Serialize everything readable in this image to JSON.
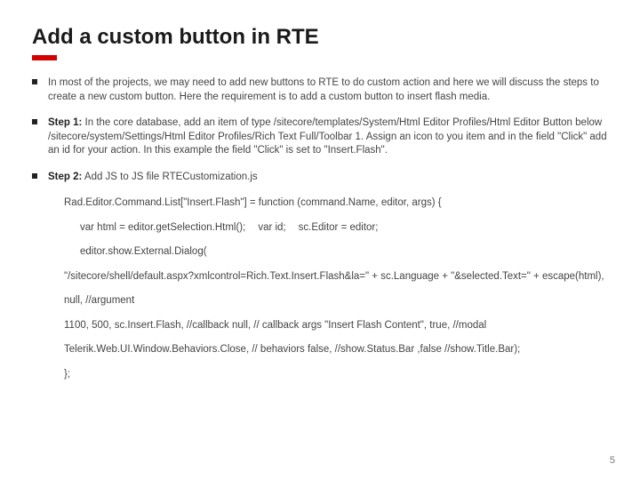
{
  "title": "Add a custom button in RTE",
  "bullets": {
    "intro": "In most of the projects, we may need to add new buttons to RTE to do custom action and here we will discuss the steps to create a new custom button. Here the requirement is to add a custom button to insert flash media.",
    "step1_label": "Step 1:",
    "step1_text": " In the core database, add an item of type /sitecore/templates/System/Html Editor Profiles/Html Editor Button below /sitecore/system/Settings/Html Editor Profiles/Rich Text Full/Toolbar 1. Assign an icon to you item and in the field \"Click\" add an id for your action. In this example the field \"Click\" is set to \"Insert.Flash\".",
    "step2_label": "Step 2:",
    "step2_text": " Add JS  to JS file RTECustomization.js"
  },
  "code": {
    "l1": "Rad.Editor.Command.List[\"Insert.Flash\"] = function (command.Name, editor, args) {",
    "l2a": "var html = editor.getSelection.Html();",
    "l2b": "var id;",
    "l2c": "sc.Editor = editor;",
    "l3": "editor.show.External.Dialog(",
    "l4": "\"/sitecore/shell/default.aspx?xmlcontrol=Rich.Text.Insert.Flash&la=\" + sc.Language + \"&selected.Text=\" + escape(html),",
    "l5": "null, //argument",
    "l6": " 1100, 500, sc.Insert.Flash, //callback null, // callback args \"Insert Flash Content\", true, //modal",
    "l7": "Telerik.Web.UI.Window.Behaviors.Close, // behaviors false, //show.Status.Bar ,false //show.Title.Bar);",
    "l8": "};"
  },
  "page_number": "5"
}
